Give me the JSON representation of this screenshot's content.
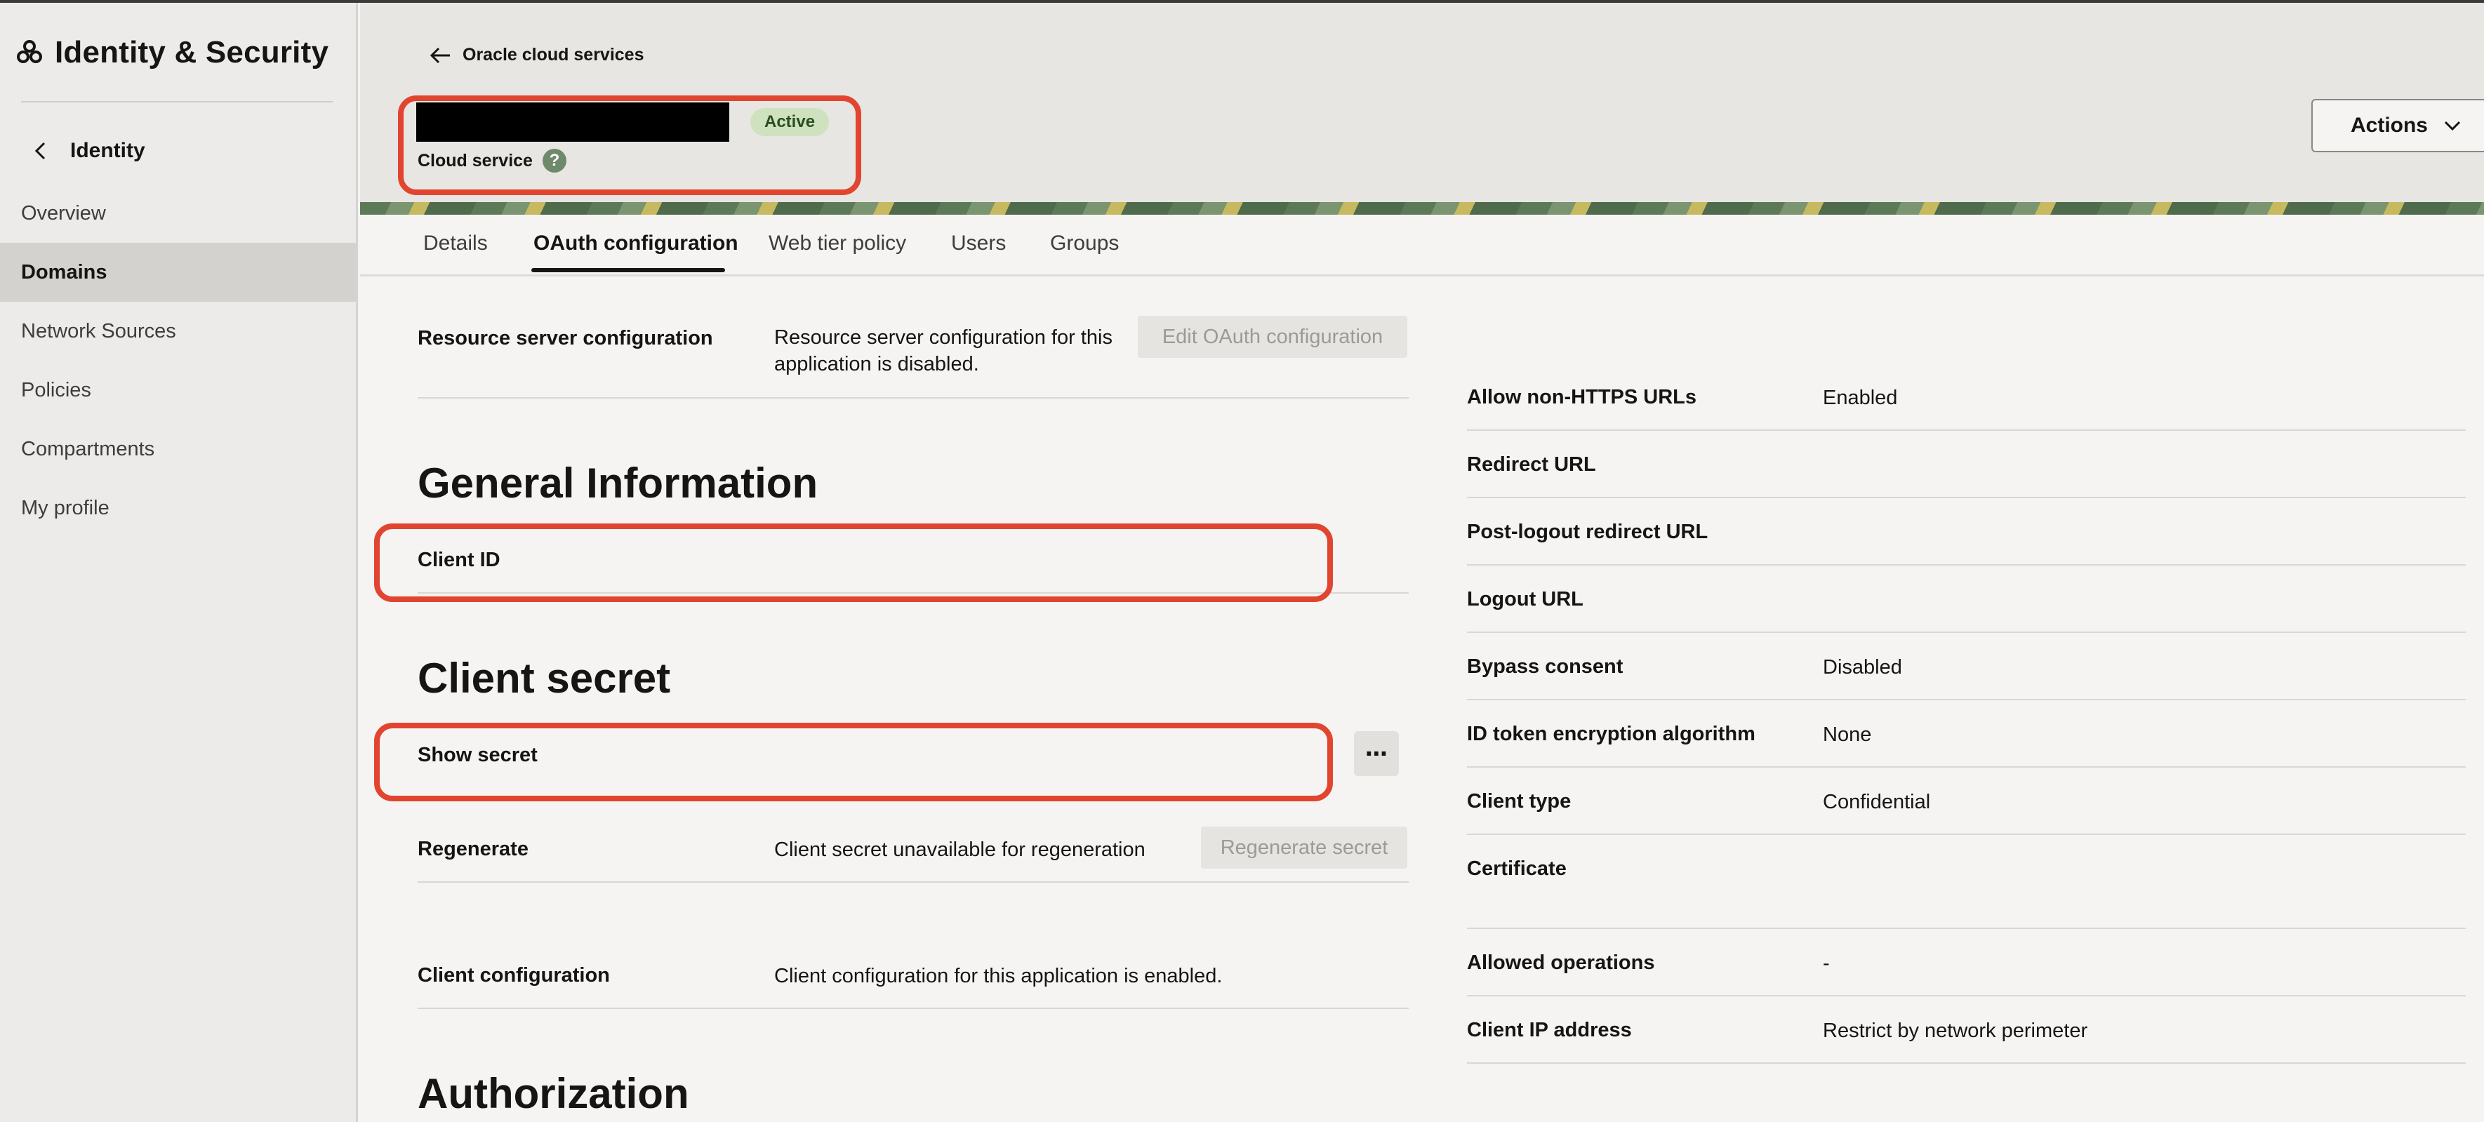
{
  "sidebar": {
    "title": "Identity & Security",
    "back_label": "Identity",
    "items": [
      {
        "label": "Overview"
      },
      {
        "label": "Domains"
      },
      {
        "label": "Network Sources"
      },
      {
        "label": "Policies"
      },
      {
        "label": "Compartments"
      },
      {
        "label": "My profile"
      }
    ]
  },
  "header": {
    "breadcrumb": "Oracle cloud services",
    "status": "Active",
    "subtitle": "Cloud service",
    "help": "?",
    "actions_label": "Actions"
  },
  "tabs": [
    {
      "label": "Details"
    },
    {
      "label": "OAuth configuration"
    },
    {
      "label": "Web tier policy"
    },
    {
      "label": "Users"
    },
    {
      "label": "Groups"
    }
  ],
  "left": {
    "resource_server_label": "Resource server configuration",
    "resource_server_value": "Resource server configuration for this application is disabled.",
    "edit_oauth_label": "Edit OAuth configuration",
    "general_heading": "General Information",
    "client_id_label": "Client ID",
    "client_secret_heading": "Client secret",
    "show_secret_label": "Show secret",
    "more_label": "⋯",
    "regenerate_label": "Regenerate",
    "regenerate_value": "Client secret unavailable for regeneration",
    "regenerate_button": "Regenerate secret",
    "client_config_label": "Client configuration",
    "client_config_value": "Client configuration for this application is enabled.",
    "authorization_heading": "Authorization"
  },
  "right": {
    "allow_http_label": "Allow non-HTTPS URLs",
    "allow_http_value": "Enabled",
    "redirect_label": "Redirect URL",
    "post_logout_label": "Post-logout redirect URL",
    "logout_label": "Logout URL",
    "bypass_label": "Bypass consent",
    "bypass_value": "Disabled",
    "id_token_label": "ID token encryption algorithm",
    "id_token_value": "None",
    "client_type_label": "Client type",
    "client_type_value": "Confidential",
    "certificate_label": "Certificate",
    "allowed_ops_label": "Allowed operations",
    "allowed_ops_value": "-",
    "client_ip_label": "Client IP address",
    "client_ip_value": "Restrict by network perimeter"
  }
}
